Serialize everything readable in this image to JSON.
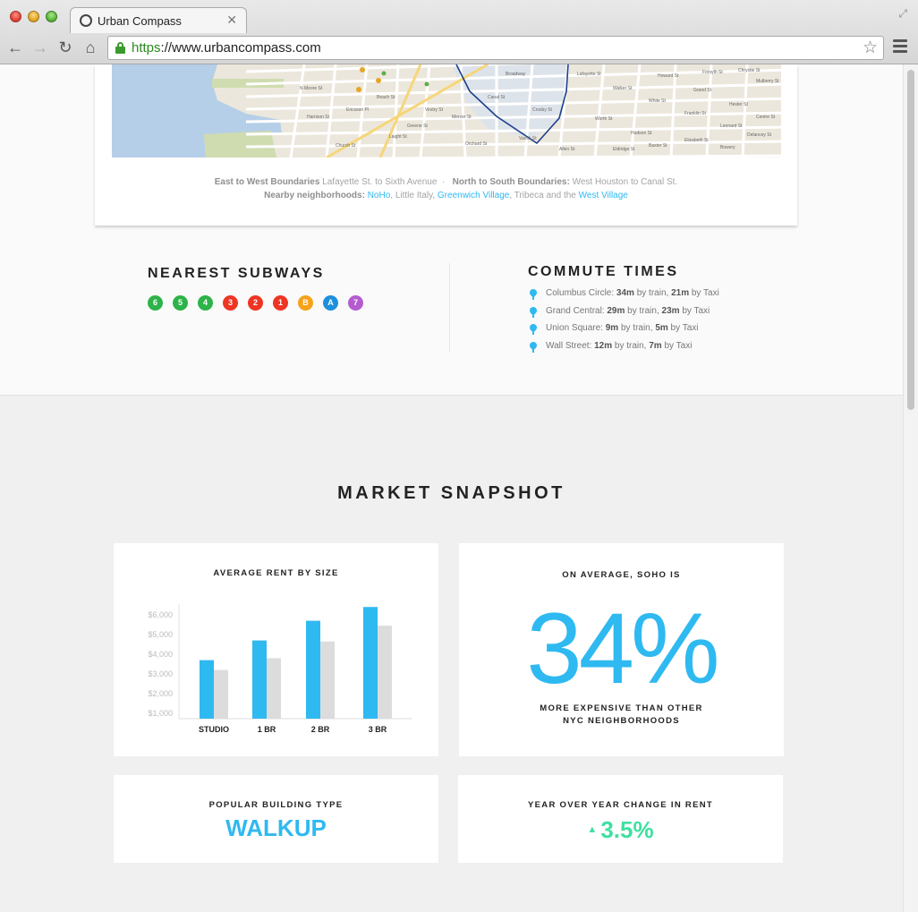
{
  "browser": {
    "tab_title": "Urban Compass",
    "url_scheme": "https",
    "url_rest": "://www.urbancompass.com"
  },
  "neighborhood": {
    "ew_label": "East to West Boundaries",
    "ew_value": "Lafayette St. to Sixth Avenue",
    "sep": "·",
    "ns_label": "North to South Boundaries:",
    "ns_value": "West Houston to Canal St.",
    "nearby_label": "Nearby neighborhoods:",
    "nearby": [
      "NoHo",
      "Little Italy",
      "Greenwich Village",
      "Tribeca",
      "West Village"
    ],
    "nearby_and": "and the",
    "map_labels": [
      "N Moore St",
      "Harrison St",
      "Ericsson Pl",
      "Beach St",
      "Laight St",
      "Vestry St",
      "Canal St",
      "Broadway",
      "Lafayette St",
      "Walker St",
      "White St",
      "Franklin St",
      "Leonard St",
      "Worth St",
      "Hudson St",
      "Varick St",
      "Church St",
      "Greene St",
      "Mercer St",
      "Crosby St",
      "Howard St",
      "Grand St",
      "Hester St",
      "Baxter St",
      "Elizabeth St",
      "Bowery",
      "Mulberry St",
      "Centre St",
      "Chrystie St",
      "Forsyth St",
      "Eldridge St",
      "Allen St",
      "Orchard St",
      "Delancey St"
    ]
  },
  "subways": {
    "title": "NEAREST SUBWAYS",
    "lines": [
      {
        "label": "6",
        "color": "#2db34a"
      },
      {
        "label": "5",
        "color": "#2db34a"
      },
      {
        "label": "4",
        "color": "#2db34a"
      },
      {
        "label": "3",
        "color": "#ee3524"
      },
      {
        "label": "2",
        "color": "#ee3524"
      },
      {
        "label": "1",
        "color": "#ee3524"
      },
      {
        "label": "B",
        "color": "#f7a21b"
      },
      {
        "label": "A",
        "color": "#1f8fdc"
      },
      {
        "label": "7",
        "color": "#b45ccf"
      }
    ]
  },
  "commute": {
    "title": "COMMUTE TIMES",
    "items": [
      {
        "place": "Columbus Circle:",
        "train": "34m",
        "train_sfx": "by train,",
        "taxi": "21m",
        "taxi_sfx": "by Taxi"
      },
      {
        "place": "Grand Central:",
        "train": "29m",
        "train_sfx": "by train,",
        "taxi": "23m",
        "taxi_sfx": "by Taxi"
      },
      {
        "place": "Union Square:",
        "train": "9m",
        "train_sfx": "by train,",
        "taxi": "5m",
        "taxi_sfx": "by Taxi"
      },
      {
        "place": "Wall Street:",
        "train": "12m",
        "train_sfx": "by train,",
        "taxi": "7m",
        "taxi_sfx": "by Taxi"
      }
    ]
  },
  "market": {
    "title": "MARKET SNAPSHOT",
    "rent_title": "AVERAGE RENT BY SIZE",
    "pct_title": "ON AVERAGE, SOHO IS",
    "pct_value": "34%",
    "pct_sub_1": "MORE EXPENSIVE THAN OTHER",
    "pct_sub_2": "NYC NEIGHBORHOODS",
    "bldg_title": "POPULAR BUILDING TYPE",
    "bldg_value": "WALKUP",
    "yoy_title": "YEAR OVER YEAR CHANGE IN RENT",
    "yoy_arrow": "▲",
    "yoy_value": "3.5%"
  },
  "chart_data": {
    "type": "bar",
    "title": "AVERAGE RENT BY SIZE",
    "categories": [
      "STUDIO",
      "1 BR",
      "2 BR",
      "3 BR"
    ],
    "series": [
      {
        "values": [
          3700,
          4700,
          5700,
          6400
        ],
        "color": "#2fb9f1"
      },
      {
        "values": [
          3200,
          3800,
          4650,
          5450
        ],
        "color": "#dcdcdc"
      }
    ],
    "yticks": [
      "$1,000",
      "$2,000",
      "$3,000",
      "$4,000",
      "$5,000",
      "$6,000"
    ],
    "ylim": [
      1000,
      6000
    ],
    "grid": false
  }
}
